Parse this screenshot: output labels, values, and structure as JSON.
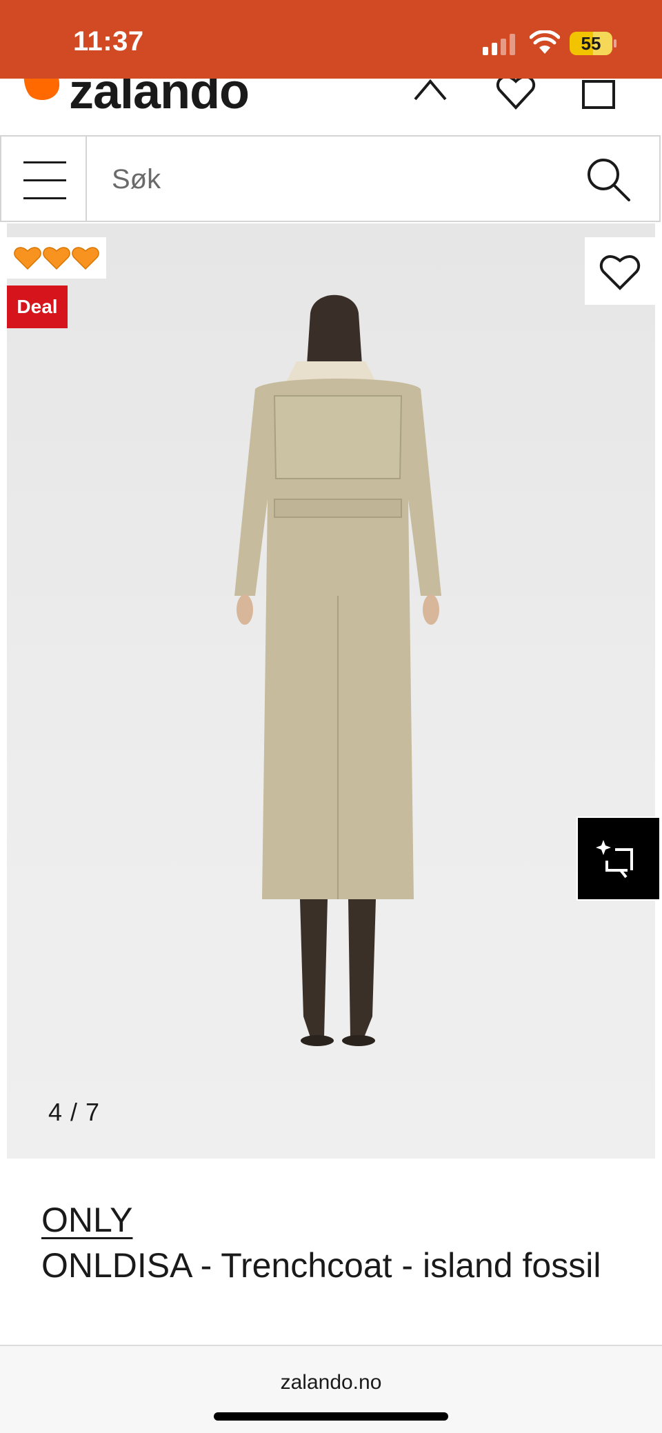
{
  "status_bar": {
    "time": "11:37",
    "battery_level": "55",
    "signal_icon": "cellular-signal-icon",
    "wifi_icon": "wifi-icon",
    "battery_icon": "battery-icon",
    "background_color": "#d14a23"
  },
  "header": {
    "logo_text": "zalando",
    "brand_color": "#ff6900",
    "icons": [
      "chevron-up-icon",
      "heart-icon",
      "shopping-bag-icon"
    ]
  },
  "search": {
    "placeholder": "Søk",
    "menu_icon": "hamburger-menu-icon",
    "search_icon": "search-icon"
  },
  "product_image": {
    "badges": {
      "hearts": [
        "🧡",
        "🧡",
        "🧡"
      ],
      "deal_label": "Deal",
      "deal_color": "#d5141c"
    },
    "wishlist_icon": "heart-outline-icon",
    "image_counter": "4 / 7",
    "ai_button_icon": "sparkle-crop-icon"
  },
  "product": {
    "brand": "ONLY",
    "title": "ONLDISA - Trenchcoat - island fossil"
  },
  "browser": {
    "url": "zalando.no"
  }
}
